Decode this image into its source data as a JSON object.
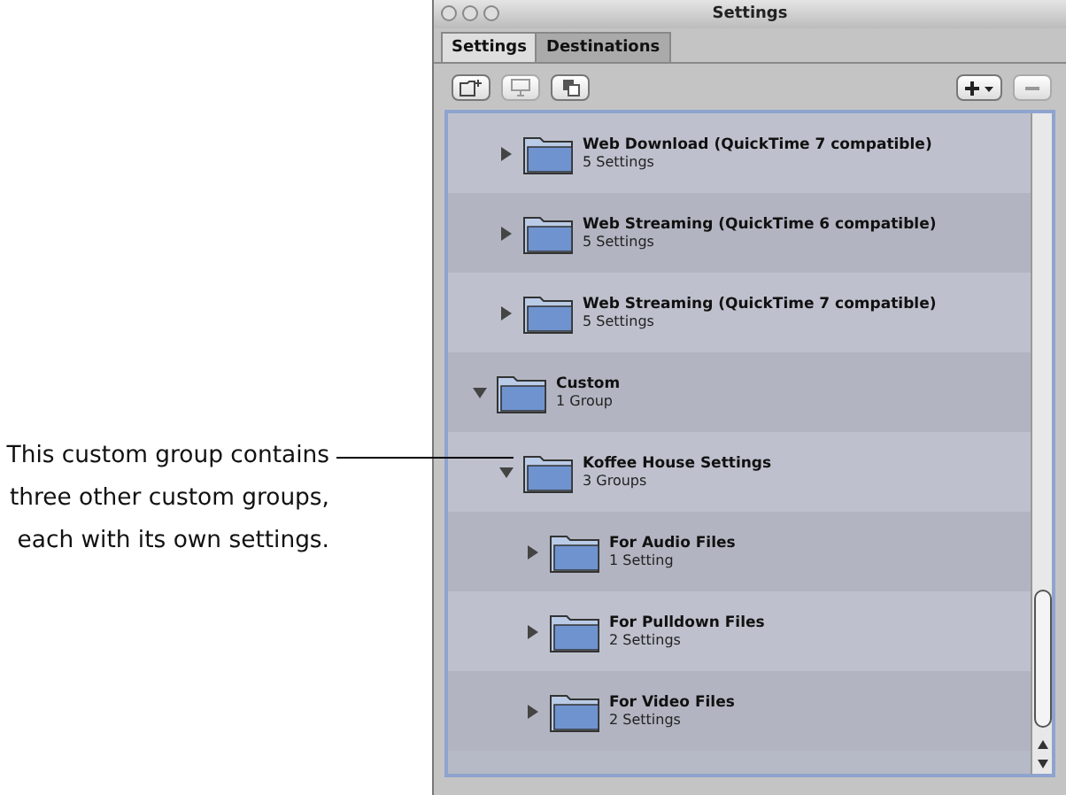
{
  "annotation": {
    "text": "This custom group contains three other custom groups, each with its own settings."
  },
  "window": {
    "title": "Settings"
  },
  "tabs": [
    {
      "label": "Settings",
      "selected": true
    },
    {
      "label": "Destinations",
      "selected": false
    }
  ],
  "tree": [
    {
      "children": [
        {
          "name": "Web Download (QuickTime 7 compatible)",
          "detail": "5 Settings",
          "expanded": false
        },
        {
          "name": "Web Streaming (QuickTime 6 compatible)",
          "detail": "5 Settings",
          "expanded": false
        },
        {
          "name": "Web Streaming (QuickTime 7 compatible)",
          "detail": "5 Settings",
          "expanded": false
        }
      ]
    },
    {
      "name": "Custom",
      "detail": "1 Group",
      "expanded": true,
      "children": [
        {
          "name": "Koffee House Settings",
          "detail": "3 Groups",
          "expanded": true,
          "children": [
            {
              "name": "For Audio Files",
              "detail": "1 Setting",
              "expanded": false
            },
            {
              "name": "For Pulldown Files",
              "detail": "2 Settings",
              "expanded": false
            },
            {
              "name": "For Video Files",
              "detail": "2 Settings",
              "expanded": false
            }
          ]
        }
      ]
    }
  ]
}
